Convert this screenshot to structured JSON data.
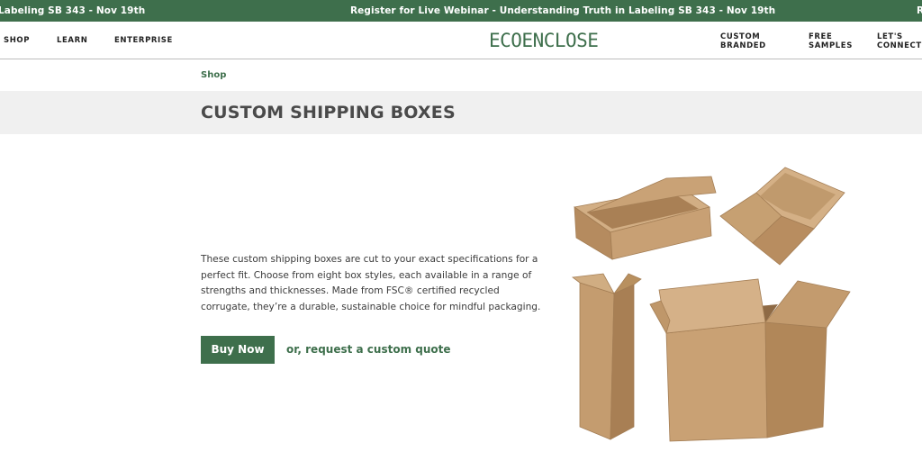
{
  "announcement": {
    "messages": [
      "Labeling SB 343 - Nov 19th",
      "Register for Live Webinar - Understanding Truth in Labeling SB 343 - Nov 19th",
      "R"
    ]
  },
  "header": {
    "nav_left": [
      "SHOP",
      "LEARN",
      "ENTERPRISE"
    ],
    "logo": "ECOENCLOSE",
    "nav_right": [
      {
        "line1": "CUSTOM",
        "line2": "BRANDED"
      },
      {
        "line1": "FREE",
        "line2": "SAMPLES"
      },
      {
        "line1": "LET'S",
        "line2": "CONNECT"
      }
    ]
  },
  "breadcrumb": "Shop",
  "page_title": "CUSTOM SHIPPING BOXES",
  "description": "These custom shipping boxes are cut to your exact specifications for a perfect fit. Choose from eight box styles, each available in a range of strengths and thicknesses. Made from FSC® certified recycled corrugate, they’re a durable, sustainable choice for mindful packaging.",
  "buttons": {
    "buy_now": "Buy Now",
    "request_quote": "or, request a custom quote"
  },
  "colors": {
    "brand_green": "#3e6f4c",
    "title_band": "#f0f0f0",
    "cardboard": "#c59e70"
  }
}
